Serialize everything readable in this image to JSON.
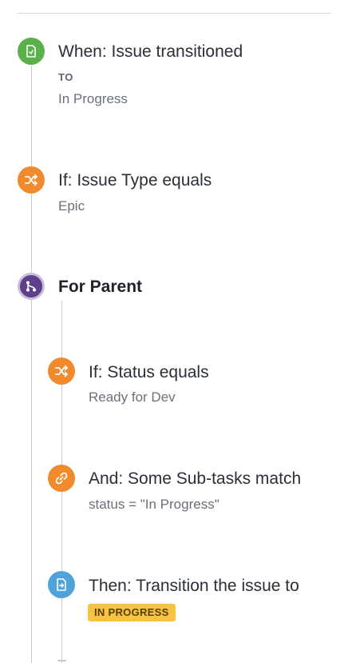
{
  "trigger": {
    "title": "When: Issue transitioned",
    "to_label": "TO",
    "to_value": "In Progress",
    "icon": "trigger-icon",
    "color": "#5ab04b"
  },
  "condition_issue_type": {
    "title": "If: Issue Type equals",
    "value": "Epic",
    "icon": "shuffle-icon",
    "color": "#f08a2c"
  },
  "branch": {
    "title": "For Parent",
    "icon": "branch-icon",
    "color": "#5f3f8c",
    "steps": [
      {
        "title": "If: Status equals",
        "value": "Ready for Dev",
        "icon": "shuffle-icon",
        "color": "#f08a2c"
      },
      {
        "title": "And: Some Sub-tasks match",
        "value": "status = \"In Progress\"",
        "icon": "link-icon",
        "color": "#f08a2c"
      },
      {
        "title": "Then: Transition the issue to",
        "badge": "IN PROGRESS",
        "icon": "transition-icon",
        "color": "#4fa3d8",
        "badge_color": "#f6c342"
      }
    ]
  }
}
